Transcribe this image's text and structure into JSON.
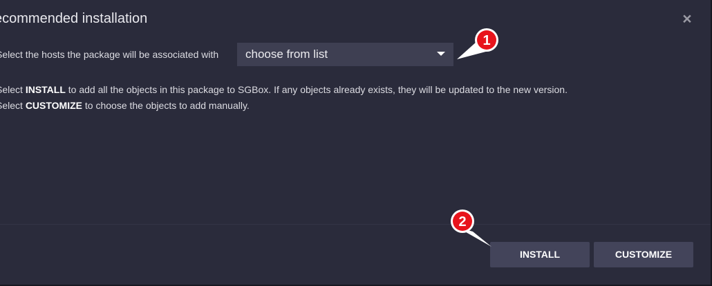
{
  "dialog": {
    "title": "ecommended installation",
    "close_glyph": "×"
  },
  "host_select": {
    "label": "Select the hosts the package will be associated with",
    "value": "choose from list"
  },
  "description": {
    "line1_prefix": "Select ",
    "line1_keyword": "INSTALL",
    "line1_suffix": " to add all the objects in this package to SGBox. If any objects already exists, they will be updated to the new version.",
    "line2_prefix": "Select ",
    "line2_keyword": "CUSTOMIZE",
    "line2_suffix": " to choose the objects to add manually."
  },
  "footer": {
    "install_label": "INSTALL",
    "customize_label": "CUSTOMIZE"
  },
  "annotations": {
    "callout_1": "1",
    "callout_2": "2",
    "color": "#e8141c"
  }
}
